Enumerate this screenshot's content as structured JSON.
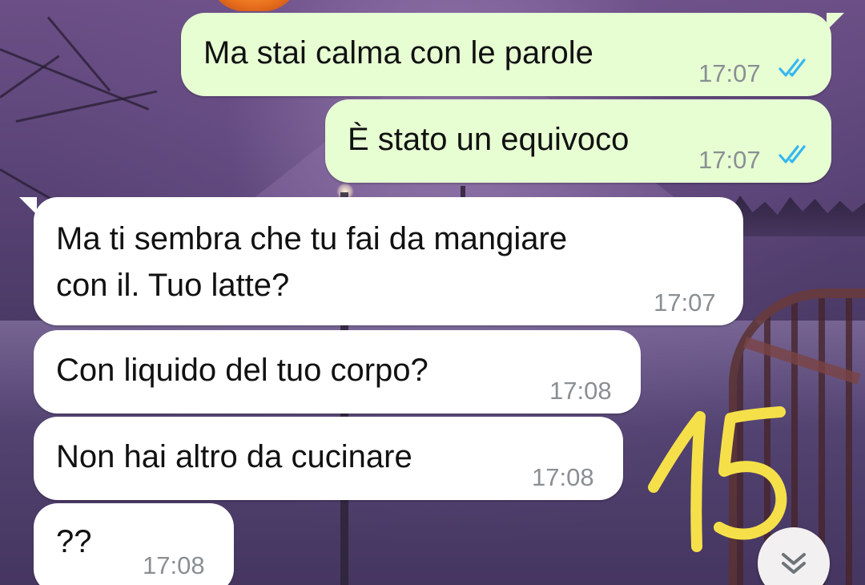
{
  "messages": [
    {
      "direction": "outgoing",
      "lines": [
        "Ma stai calma con le parole"
      ],
      "time": "17:07",
      "status": "read"
    },
    {
      "direction": "outgoing",
      "lines": [
        "È stato un equivoco"
      ],
      "time": "17:07",
      "status": "read"
    },
    {
      "direction": "incoming",
      "lines": [
        "Ma ti sembra che tu fai da mangiare",
        "con il. Tuo latte?"
      ],
      "time": "17:07"
    },
    {
      "direction": "incoming",
      "lines": [
        "Con liquido del tuo corpo?"
      ],
      "time": "17:08"
    },
    {
      "direction": "incoming",
      "lines": [
        "Non hai altro da cucinare"
      ],
      "time": "17:08"
    },
    {
      "direction": "incoming",
      "lines": [
        "??"
      ],
      "time": "17:08"
    }
  ],
  "annotation": {
    "text": "15",
    "color": "#f5e04a"
  },
  "colors": {
    "outgoing_bubble": "#e7fed3",
    "incoming_bubble": "#ffffff",
    "read_ticks": "#34b7f1",
    "timestamp": "#8a8f93"
  },
  "icons": {
    "read_receipt": "double-check-icon",
    "scroll_down": "chevrons-down-icon"
  }
}
